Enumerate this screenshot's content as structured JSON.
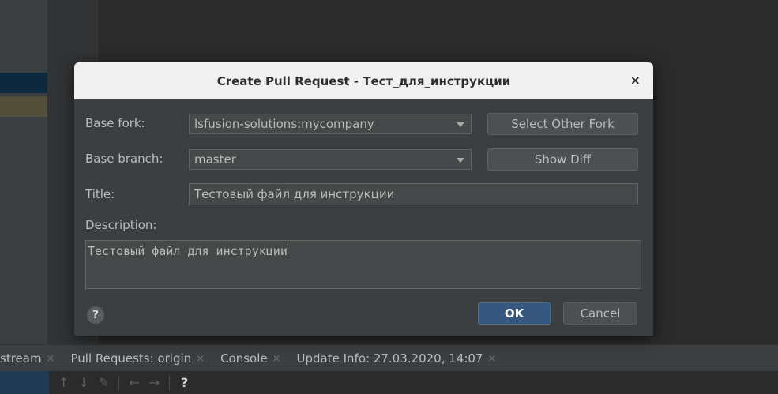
{
  "dialog": {
    "title": "Create Pull Request - Тест_для_инструкции",
    "close_icon": "×",
    "base_fork_label": "Base fork:",
    "base_fork_value": "lsfusion-solutions:mycompany",
    "select_other_fork_label": "Select Other Fork",
    "base_branch_label": "Base branch:",
    "base_branch_value": "master",
    "show_diff_label": "Show Diff",
    "title_label": "Title:",
    "title_value": "Тестовый файл для инструкции",
    "description_label": "Description:",
    "description_value": "Тестовый файл для инструкции",
    "help_label": "?",
    "ok_label": "OK",
    "cancel_label": "Cancel"
  },
  "bottom_tabs": [
    {
      "label": "stream"
    },
    {
      "label": "Pull Requests: origin"
    },
    {
      "label": "Console"
    },
    {
      "label": "Update Info: 27.03.2020, 14:07"
    }
  ],
  "tab_close": "×",
  "toolbar": {
    "icons": [
      "arrow-up-icon",
      "arrow-down-icon",
      "edit-icon",
      "arrow-left-icon",
      "arrow-right-icon"
    ],
    "help_label": "?"
  },
  "colors": {
    "ok_button": "#365880",
    "dialog_background": "#3c3f41",
    "titlebar": "#f0f0f0"
  }
}
